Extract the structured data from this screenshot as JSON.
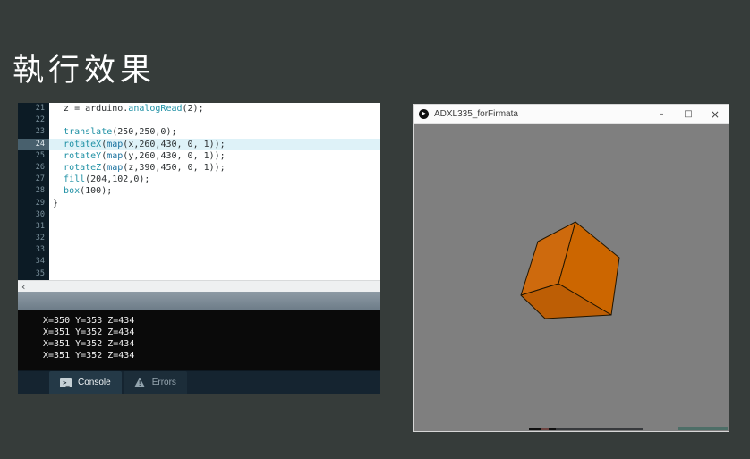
{
  "slide": {
    "title": "執行效果"
  },
  "ide": {
    "editor": {
      "current_line": 24,
      "lines": [
        {
          "no": "21",
          "tokens": [
            [
              "p",
              "  z = arduino."
            ],
            [
              "f",
              "analogRead"
            ],
            [
              "p",
              "(2);"
            ]
          ]
        },
        {
          "no": "22",
          "tokens": []
        },
        {
          "no": "23",
          "tokens": [
            [
              "p",
              "  "
            ],
            [
              "f",
              "translate"
            ],
            [
              "p",
              "(250,250,0);"
            ]
          ]
        },
        {
          "no": "24",
          "tokens": [
            [
              "p",
              "  "
            ],
            [
              "f",
              "rotateX"
            ],
            [
              "p",
              "("
            ],
            [
              "f2",
              "map"
            ],
            [
              "p",
              "(x,260,430, 0, 1));"
            ]
          ]
        },
        {
          "no": "25",
          "tokens": [
            [
              "p",
              "  "
            ],
            [
              "f",
              "rotateY"
            ],
            [
              "p",
              "("
            ],
            [
              "f2",
              "map"
            ],
            [
              "p",
              "(y,260,430, 0, 1));"
            ]
          ]
        },
        {
          "no": "26",
          "tokens": [
            [
              "p",
              "  "
            ],
            [
              "f",
              "rotateZ"
            ],
            [
              "p",
              "("
            ],
            [
              "f2",
              "map"
            ],
            [
              "p",
              "(z,390,450, 0, 1));"
            ]
          ]
        },
        {
          "no": "27",
          "tokens": [
            [
              "p",
              "  "
            ],
            [
              "f",
              "fill"
            ],
            [
              "p",
              "(204,102,0);"
            ]
          ]
        },
        {
          "no": "28",
          "tokens": [
            [
              "p",
              "  "
            ],
            [
              "f",
              "box"
            ],
            [
              "p",
              "(100);"
            ]
          ]
        },
        {
          "no": "29",
          "tokens": [
            [
              "p",
              "}"
            ]
          ]
        },
        {
          "no": "30",
          "tokens": []
        },
        {
          "no": "31",
          "tokens": []
        },
        {
          "no": "32",
          "tokens": []
        },
        {
          "no": "33",
          "tokens": []
        },
        {
          "no": "34",
          "tokens": []
        },
        {
          "no": "35",
          "tokens": []
        }
      ],
      "scroll_left_arrow": "‹"
    },
    "console": {
      "lines": [
        "X=350 Y=353 Z=434",
        "X=351 Y=352 Z=434",
        "X=351 Y=352 Z=434",
        "X=351 Y=352 Z=434"
      ],
      "tabs": [
        {
          "label": "Console",
          "icon_glyph": ">_",
          "active": true
        },
        {
          "label": "Errors",
          "icon_glyph": "!",
          "active": false
        }
      ]
    }
  },
  "sketch_window": {
    "title": "ADXL335_forFirmata",
    "play_icon_glyph": "▶",
    "controls": {
      "minimize": "–",
      "maximize": "□",
      "close": "×"
    },
    "cube": {
      "fill_left": "#ce6a0d",
      "fill_right": "#cc6600",
      "fill_bottom": "#bd5e05",
      "stroke": "#221500"
    }
  },
  "colors": {
    "slide_background": "#363c3a",
    "canvas_gray": "#7f7f7f",
    "cube_orange": "#cc6600",
    "current_line_highlight": "#def2f8",
    "gutter_background": "#0c1b25",
    "console_background": "#0a0a0a",
    "tab_bar_background": "#152430"
  }
}
